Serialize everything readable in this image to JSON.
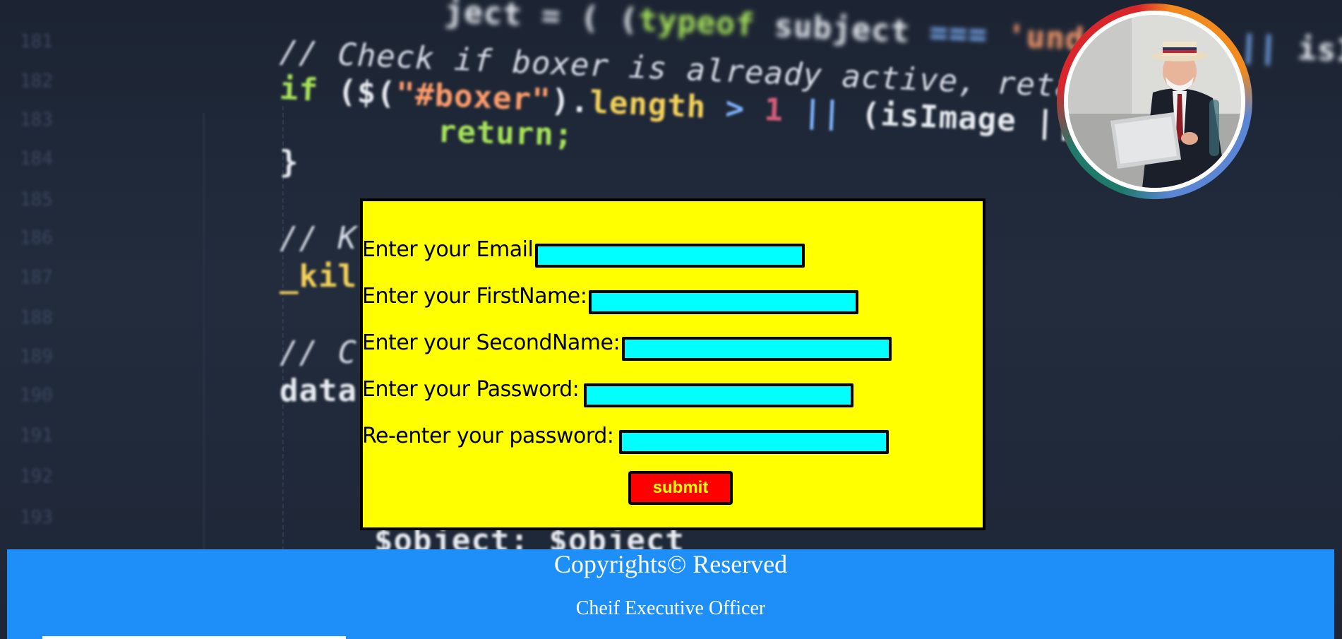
{
  "background_code": {
    "line_numbers": [
      "181",
      "182",
      "183",
      "184",
      "185",
      "186",
      "187",
      "188",
      "189",
      "190",
      "191",
      "192",
      "193"
    ],
    "lines": [
      {
        "tokens": [
          {
            "t": "    ject ",
            "c": "plain"
          },
          {
            "t": "= ( (",
            "c": "plain"
          },
          {
            "t": "typeof",
            "c": "kw"
          },
          {
            "t": " subject ",
            "c": "plain"
          },
          {
            "t": "=== ",
            "c": "var"
          },
          {
            "t": "'undefined'",
            "c": "str"
          },
          {
            "t": " || ",
            "c": "var"
          },
          {
            "t": "isImage",
            "c": "plain"
          }
        ]
      },
      {
        "tokens": [
          {
            "t": "// Check if boxer is already active, retain values",
            "c": "comment"
          }
        ]
      },
      {
        "tokens": [
          {
            "t": "if",
            "c": "kw"
          },
          {
            "t": " ($(",
            "c": "plain"
          },
          {
            "t": "\"#boxer\"",
            "c": "str"
          },
          {
            "t": ").",
            "c": "plain"
          },
          {
            "t": "length",
            "c": "fn"
          },
          {
            "t": " > ",
            "c": "var"
          },
          {
            "t": "1",
            "c": "op"
          },
          {
            "t": " || ",
            "c": "var"
          },
          {
            "t": "(isImage || isVideo",
            "c": "plain"
          }
        ]
      },
      {
        "tokens": [
          {
            "t": "    return;",
            "c": "kw"
          }
        ]
      },
      {
        "tokens": [
          {
            "t": "}",
            "c": "plain"
          }
        ]
      },
      {
        "tokens": [
          {
            "t": "// K",
            "c": "comment"
          }
        ]
      },
      {
        "tokens": [
          {
            "t": "_kil",
            "c": "fn"
          }
        ]
      },
      {
        "tokens": [
          {
            "t": "// C",
            "c": "comment"
          }
        ]
      },
      {
        "tokens": [
          {
            "t": "data",
            "c": "plain"
          }
        ]
      },
      {
        "tokens": [
          {
            "t": "    $object: $object",
            "c": "plain"
          }
        ]
      }
    ]
  },
  "avatar": {
    "alt": "man-with-laptop-photo"
  },
  "form": {
    "fields": [
      {
        "label": "Enter your Email:",
        "value": "",
        "placeholder": ""
      },
      {
        "label": "Enter your FirstName:",
        "value": "",
        "placeholder": ""
      },
      {
        "label": "Enter your SecondName:",
        "value": "",
        "placeholder": ""
      },
      {
        "label": "Enter your Password:",
        "value": "",
        "placeholder": ""
      },
      {
        "label": "Re-enter your password:",
        "value": "",
        "placeholder": ""
      }
    ],
    "submit_label": "submit"
  },
  "footer": {
    "copyright": "Copyrights©  Reserved",
    "title": "Cheif Executive Officer"
  },
  "colors": {
    "form_bg": "#ffff00",
    "field_bg": "#00ffff",
    "submit_bg": "#ff0000",
    "submit_text": "#ffff00",
    "footer_bg": "#1e8ff8",
    "page_bg": "#1f2838"
  }
}
